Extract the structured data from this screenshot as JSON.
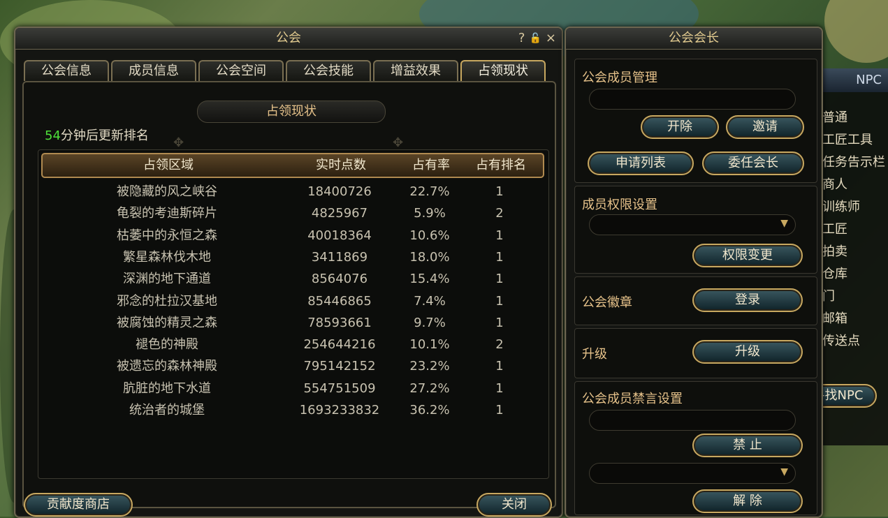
{
  "guild_window": {
    "title": "公会",
    "tabs": [
      "公会信息",
      "成员信息",
      "公会空间",
      "公会技能",
      "增益效果",
      "占领现状"
    ],
    "active_tab": 5,
    "section_title": "占领现状",
    "update_minutes": "54",
    "update_text": "分钟后更新排名",
    "columns": [
      "占领区域",
      "实时点数",
      "占有率",
      "占有排名"
    ],
    "rows": [
      {
        "area": "被隐藏的风之峡谷",
        "points": "18400726",
        "rate": "22.7%",
        "rank": "1"
      },
      {
        "area": "龟裂的考迪斯碎片",
        "points": "4825967",
        "rate": "5.9%",
        "rank": "2"
      },
      {
        "area": "枯萎中的永恒之森",
        "points": "40018364",
        "rate": "10.6%",
        "rank": "1"
      },
      {
        "area": "繁星森林伐木地",
        "points": "3411869",
        "rate": "18.0%",
        "rank": "1"
      },
      {
        "area": "深渊的地下通道",
        "points": "8564076",
        "rate": "15.4%",
        "rank": "1"
      },
      {
        "area": "邪念的杜拉汉基地",
        "points": "85446865",
        "rate": "7.4%",
        "rank": "1"
      },
      {
        "area": "被腐蚀的精灵之森",
        "points": "78593661",
        "rate": "9.7%",
        "rank": "1"
      },
      {
        "area": "褪色的神殿",
        "points": "254644216",
        "rate": "10.1%",
        "rank": "2"
      },
      {
        "area": "被遗忘的森林神殿",
        "points": "795142152",
        "rate": "23.2%",
        "rank": "1"
      },
      {
        "area": "肮脏的地下水道",
        "points": "554751509",
        "rate": "27.2%",
        "rank": "1"
      },
      {
        "area": "统治者的城堡",
        "points": "1693233832",
        "rate": "36.2%",
        "rank": "1"
      }
    ],
    "shop_button": "贡献度商店",
    "close_button": "关闭",
    "help_icon": "?",
    "lock_icon": "🔓",
    "close_icon": "×"
  },
  "leader_window": {
    "title": "公会会长",
    "member_mgmt_label": "公会成员管理",
    "kick_button": "开除",
    "invite_button": "邀请",
    "apply_list_button": "申请列表",
    "delegate_button": "委任会长",
    "permission_label": "成员权限设置",
    "permission_change_button": "权限变更",
    "emblem_label": "公会徽章",
    "register_button": "登录",
    "upgrade_label": "升级",
    "upgrade_button": "升级",
    "mute_label": "公会成员禁言设置",
    "mute_button": "禁 止",
    "unmute_button": "解 除"
  },
  "npc_panel": {
    "header": "NPC",
    "items": [
      "普通",
      "工匠工具",
      "任务告示栏",
      "商人",
      "训练师",
      "工匠",
      "拍卖",
      "仓库",
      "门",
      "邮箱",
      "传送点"
    ],
    "find_button": "寻找NPC"
  },
  "colors": {
    "accent_gold": "#c8a860",
    "highlight_green": "#4ee03a",
    "panel_bg": "#141512"
  }
}
